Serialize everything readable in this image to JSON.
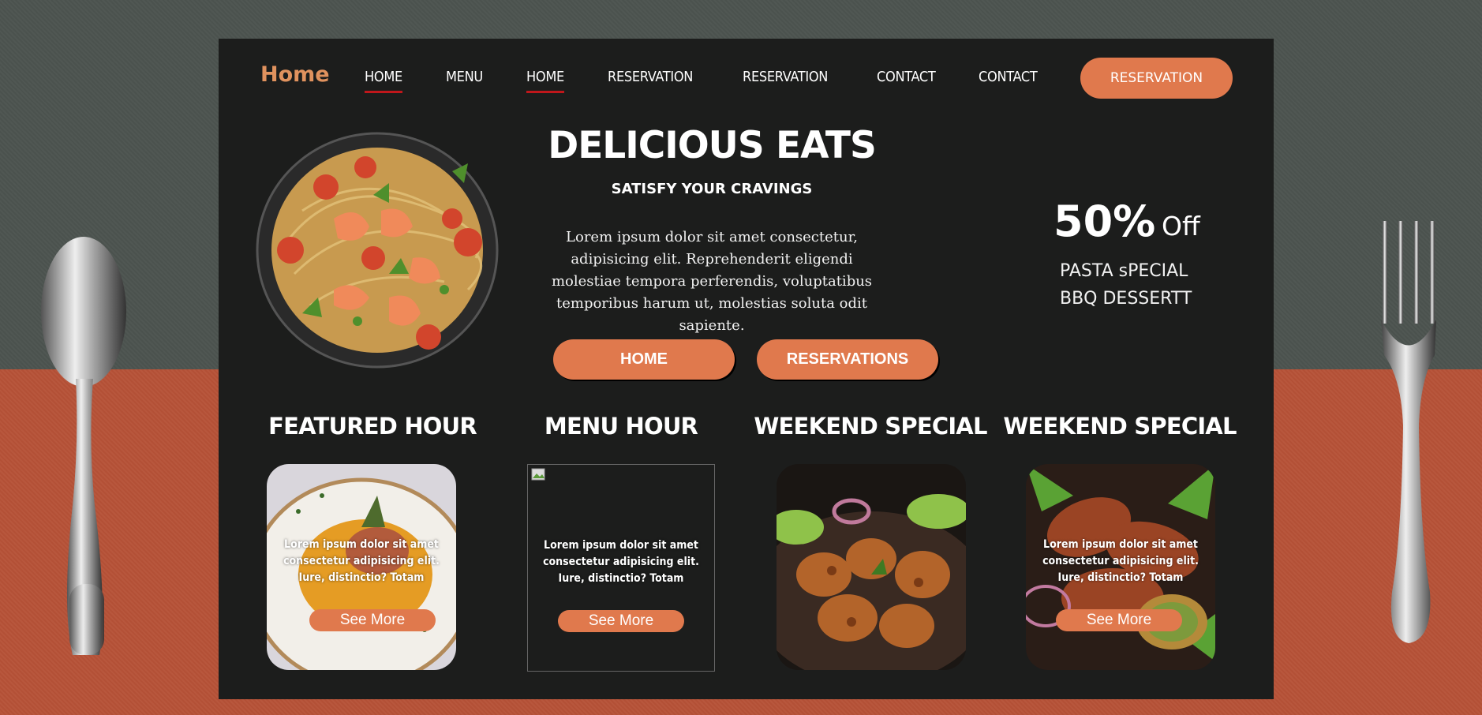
{
  "brand": "Home",
  "nav": [
    "HOME",
    "MENU",
    "HOME",
    "RESERVATION",
    "RESERVATION",
    "CONTACT",
    "CONTACT"
  ],
  "nav_cta": "RESERVATION",
  "hero": {
    "title": "DELICIOUS EATS",
    "subtitle": "SATISFY YOUR CRAVINGS",
    "text": "Lorem ipsum dolor sit amet consectetur, adipisicing elit. Reprehenderit eligendi molestiae tempora perferendis, voluptatibus temporibus harum ut, molestias soluta odit sapiente.",
    "button_home": "HOME",
    "button_reservations": "RESERVATIONS"
  },
  "promo": {
    "percent": "50%",
    "off": "Off",
    "line1": "PASTA sPECIAL",
    "line2": "BBQ DESSERTT"
  },
  "cards": [
    {
      "heading": "FEATURED HOUR",
      "text": "Lorem ipsum dolor sit amet consectetur adipisicing elit. Iure, distinctio? Totam",
      "button": "See More"
    },
    {
      "heading": "MENU HOUR",
      "text": "Lorem ipsum dolor sit amet consectetur adipisicing elit. Iure, distinctio? Totam",
      "button": "See More"
    },
    {
      "heading": "WEEKEND SPECIAL"
    },
    {
      "heading": "WEEKEND SPECIAL",
      "text": "Lorem ipsum dolor sit amet consectetur adipisicing elit. Iure, distinctio? Totam",
      "button": "See More"
    }
  ],
  "colors": {
    "accent": "#e0794d",
    "brand": "#e0925e",
    "panel": "#1c1d1c",
    "nav_underline": "#c0171b"
  }
}
